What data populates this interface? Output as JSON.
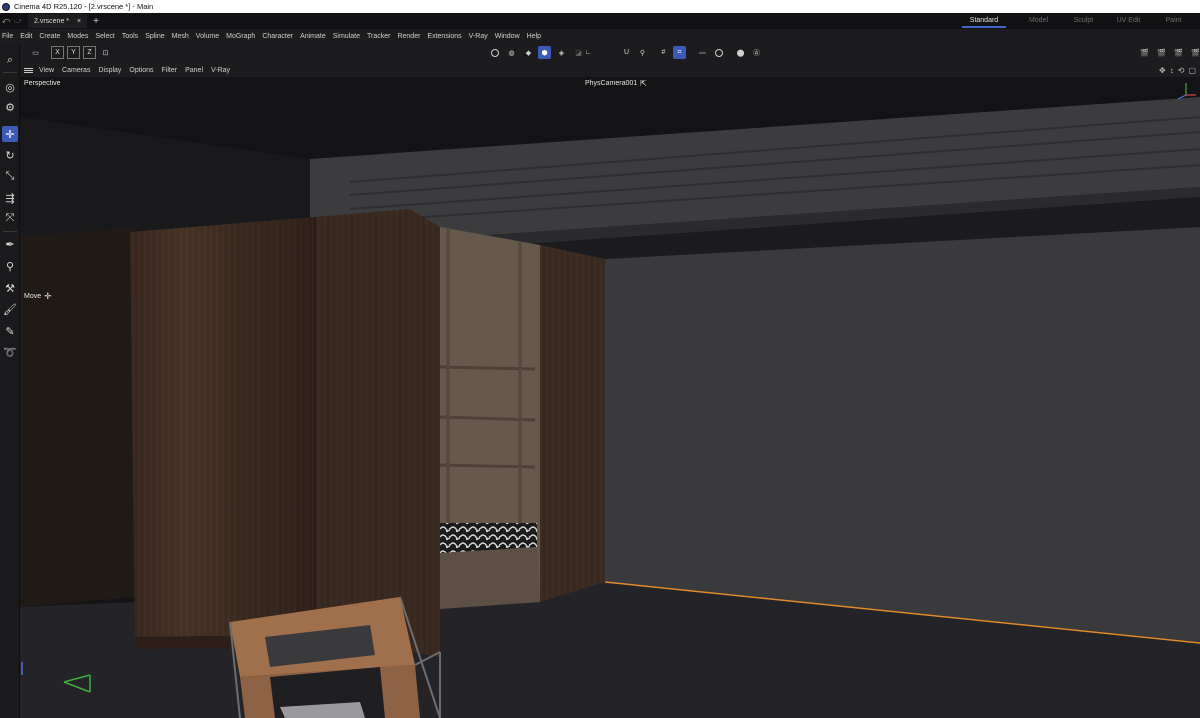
{
  "window": {
    "title": "Cinema 4D R25.120 - [2.vrscene *] - Main"
  },
  "tabs": {
    "document": "2.vrscene *",
    "close": "×",
    "add": "+"
  },
  "layouts": [
    "Standard",
    "Model",
    "Sculpt",
    "UV Edit",
    "Paint"
  ],
  "menu": [
    "File",
    "Edit",
    "Create",
    "Modes",
    "Select",
    "Tools",
    "Spline",
    "Mesh",
    "Volume",
    "MoGraph",
    "Character",
    "Animate",
    "Simulate",
    "Tracker",
    "Render",
    "Extensions",
    "V-Ray",
    "Window",
    "Help"
  ],
  "toolbar": {
    "axis_x": "X",
    "axis_y": "Y",
    "axis_z": "Z"
  },
  "viewport_menu": [
    "View",
    "Cameras",
    "Display",
    "Options",
    "Filter",
    "Panel",
    "V-Ray"
  ],
  "viewport": {
    "projection": "Perspective",
    "camera": "PhysCamera001",
    "tool_hint": "Move"
  },
  "colors": {
    "accent": "#3c5ab8",
    "selection_edge": "#e08a2a",
    "background": "#1c1c1e"
  }
}
